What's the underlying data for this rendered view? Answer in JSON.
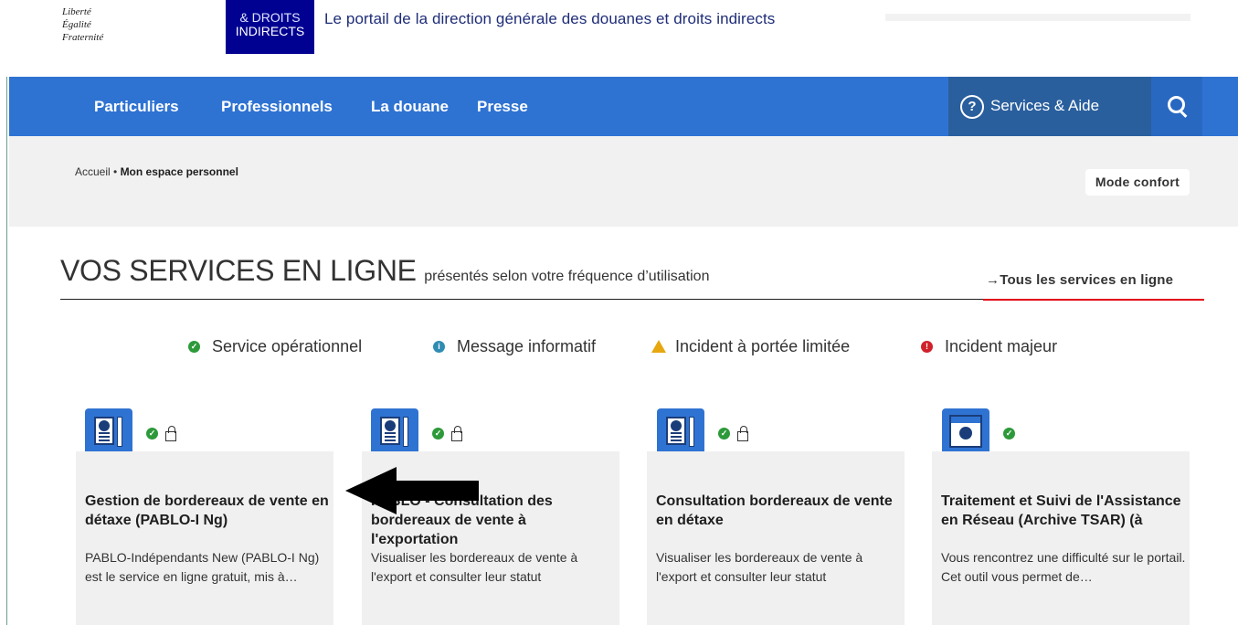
{
  "header": {
    "motto": [
      "Liberté",
      "Égalité",
      "Fraternité"
    ],
    "logo_lines": [
      "& DROITS",
      "INDIRECTS"
    ],
    "portal_title": "Le portail de la direction générale des douanes et droits indirects"
  },
  "nav": {
    "items": [
      "Particuliers",
      "Professionnels",
      "La douane",
      "Presse"
    ],
    "services_label": "Services & Aide",
    "services_icon": "question-circle-icon",
    "search_icon": "search-icon"
  },
  "breadcrumb": {
    "home": "Accueil",
    "separator": " • ",
    "current": "Mon espace personnel"
  },
  "mode_button": "Mode confort",
  "section": {
    "title": "VOS SERVICES EN LIGNE",
    "subtitle": "présentés selon votre fréquence d’utilisation",
    "all_link": "→Tous les services en ligne"
  },
  "legend": [
    {
      "label": "Service opérationnel",
      "icon": "check-circle-icon",
      "color": "#2d9a3a"
    },
    {
      "label": "Message informatif",
      "icon": "info-circle-icon",
      "color": "#2f8cb3"
    },
    {
      "label": "Incident à portée limitée",
      "icon": "warning-triangle-icon",
      "color": "#e6a70f"
    },
    {
      "label": "Incident majeur",
      "icon": "error-circle-icon",
      "color": "#d0212b"
    }
  ],
  "cards": [
    {
      "title": "Gestion de bordereaux de vente en détaxe (PABLO-I Ng)",
      "description": "PABLO-Indépendants New (PABLO-I Ng) est le service en ligne gratuit, mis à…"
    },
    {
      "title": "PABLO - Consultation des bordereaux de vente à l'exportation",
      "description": "Visualiser les bordereaux de vente à l'export et consulter leur statut"
    },
    {
      "title": "Consultation bordereaux de vente en détaxe",
      "description": "Visualiser les bordereaux de vente à l'export et consulter leur statut"
    },
    {
      "title": "Traitement et Suivi de l'Assistance en Réseau (Archive TSAR) (à",
      "description": "Vous rencontrez une difficulté sur le portail. Cet outil vous permet de…"
    }
  ],
  "colors": {
    "nav_blue": "#2f73d2",
    "services_blue": "#2a5f9e",
    "marianne_blue": "#000091",
    "accent_red": "#e1000f"
  }
}
